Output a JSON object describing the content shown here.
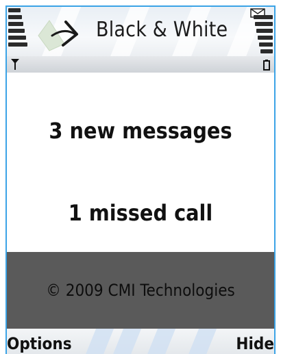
{
  "app": {
    "title": "Black & White"
  },
  "notifications": {
    "messages": "3 new messages",
    "missed_calls": "1 missed call"
  },
  "footer": {
    "copyright": "© 2009 CMI Technologies"
  },
  "softkeys": {
    "left": "Options",
    "right": "Hide"
  },
  "colors": {
    "frame_border": "#3aa3e6",
    "band": "#5a5a5a"
  },
  "icons": [
    "signal-strength-icon",
    "app-logo-icon",
    "mail-icon",
    "battery-level-icon",
    "antenna-icon",
    "battery-icon"
  ]
}
